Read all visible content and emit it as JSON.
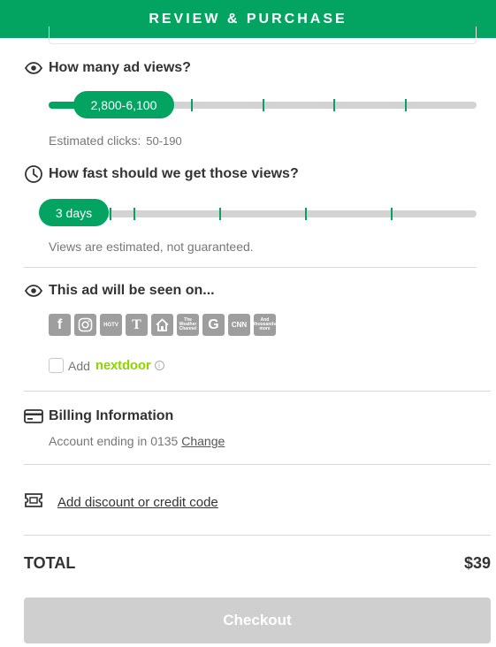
{
  "header": {
    "title": "REVIEW & PURCHASE"
  },
  "ad_views": {
    "title": "How many ad views?",
    "selected": "2,800-6,100",
    "estimated_label": "Estimated clicks:",
    "estimated_value": "50-190"
  },
  "speed": {
    "title": "How fast should we get those views?",
    "selected": "3 days",
    "note": "Views are estimated, not guaranteed."
  },
  "placements": {
    "title": "This ad will be seen on...",
    "channels": [
      {
        "icon": "facebook-icon",
        "text": "f"
      },
      {
        "icon": "instagram-icon",
        "text": ""
      },
      {
        "icon": "hgtv-icon",
        "text": "HGTV"
      },
      {
        "icon": "nyt-icon",
        "text": "T"
      },
      {
        "icon": "home-icon",
        "text": ""
      },
      {
        "icon": "weather-channel-icon",
        "text": "The Weather Channel"
      },
      {
        "icon": "google-icon",
        "text": "G"
      },
      {
        "icon": "cnn-icon",
        "text": "CNN"
      },
      {
        "icon": "more-sites-icon",
        "text": "And thousands more"
      }
    ],
    "add_label": "Add",
    "nextdoor": "nextdoor"
  },
  "billing": {
    "title": "Billing Information",
    "account_text": "Account ending in 0135",
    "change_link": "Change"
  },
  "discount": {
    "link": "Add discount or credit code"
  },
  "total": {
    "label": "TOTAL",
    "value": "$39"
  },
  "checkout": {
    "label": "Checkout"
  },
  "colors": {
    "brand": "#03a462",
    "disabled_button": "#cfcfcf"
  }
}
